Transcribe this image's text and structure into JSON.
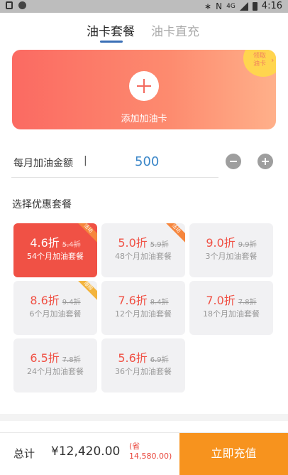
{
  "status_bar": {
    "time": "4:16",
    "network": "4G"
  },
  "tabs": [
    {
      "label": "油卡套餐",
      "active": true
    },
    {
      "label": "油卡直充",
      "active": false
    }
  ],
  "card": {
    "add_label": "添加加油卡",
    "badge_line1": "领取",
    "badge_line2": "油卡",
    "badge_chevron": "›"
  },
  "amount": {
    "label": "每月加油金额",
    "separator": "|",
    "value": "500"
  },
  "section_title": "选择优惠套餐",
  "packages": [
    {
      "discount": "4.6折",
      "original": "5.4折",
      "desc": "54个月加油套餐",
      "tag": "活动",
      "selected": true
    },
    {
      "discount": "5.0折",
      "original": "5.9折",
      "desc": "48个月加油套餐",
      "tag": "活动"
    },
    {
      "discount": "9.0折",
      "original": "9.9折",
      "desc": "3个月加油套餐"
    },
    {
      "discount": "8.6折",
      "original": "9.4折",
      "desc": "6个月加油套餐",
      "tag": "限购"
    },
    {
      "discount": "7.6折",
      "original": "8.4折",
      "desc": "12个月加油套餐"
    },
    {
      "discount": "7.0折",
      "original": "7.8折",
      "desc": "18个月加油套餐"
    },
    {
      "discount": "6.5折",
      "original": "7.8折",
      "desc": "24个月加油套餐"
    },
    {
      "discount": "5.6折",
      "original": "6.9折",
      "desc": "36个月加油套餐"
    }
  ],
  "bottom": {
    "total_label": "总计",
    "total_value": "¥12,420.00",
    "save_note_line1": "(省",
    "save_note_line2": "14,580.00)",
    "charge_button": "立即充值"
  },
  "colors": {
    "accent_blue": "#3a86c8",
    "package_red": "#f05145",
    "charge_orange": "#f7931e"
  }
}
